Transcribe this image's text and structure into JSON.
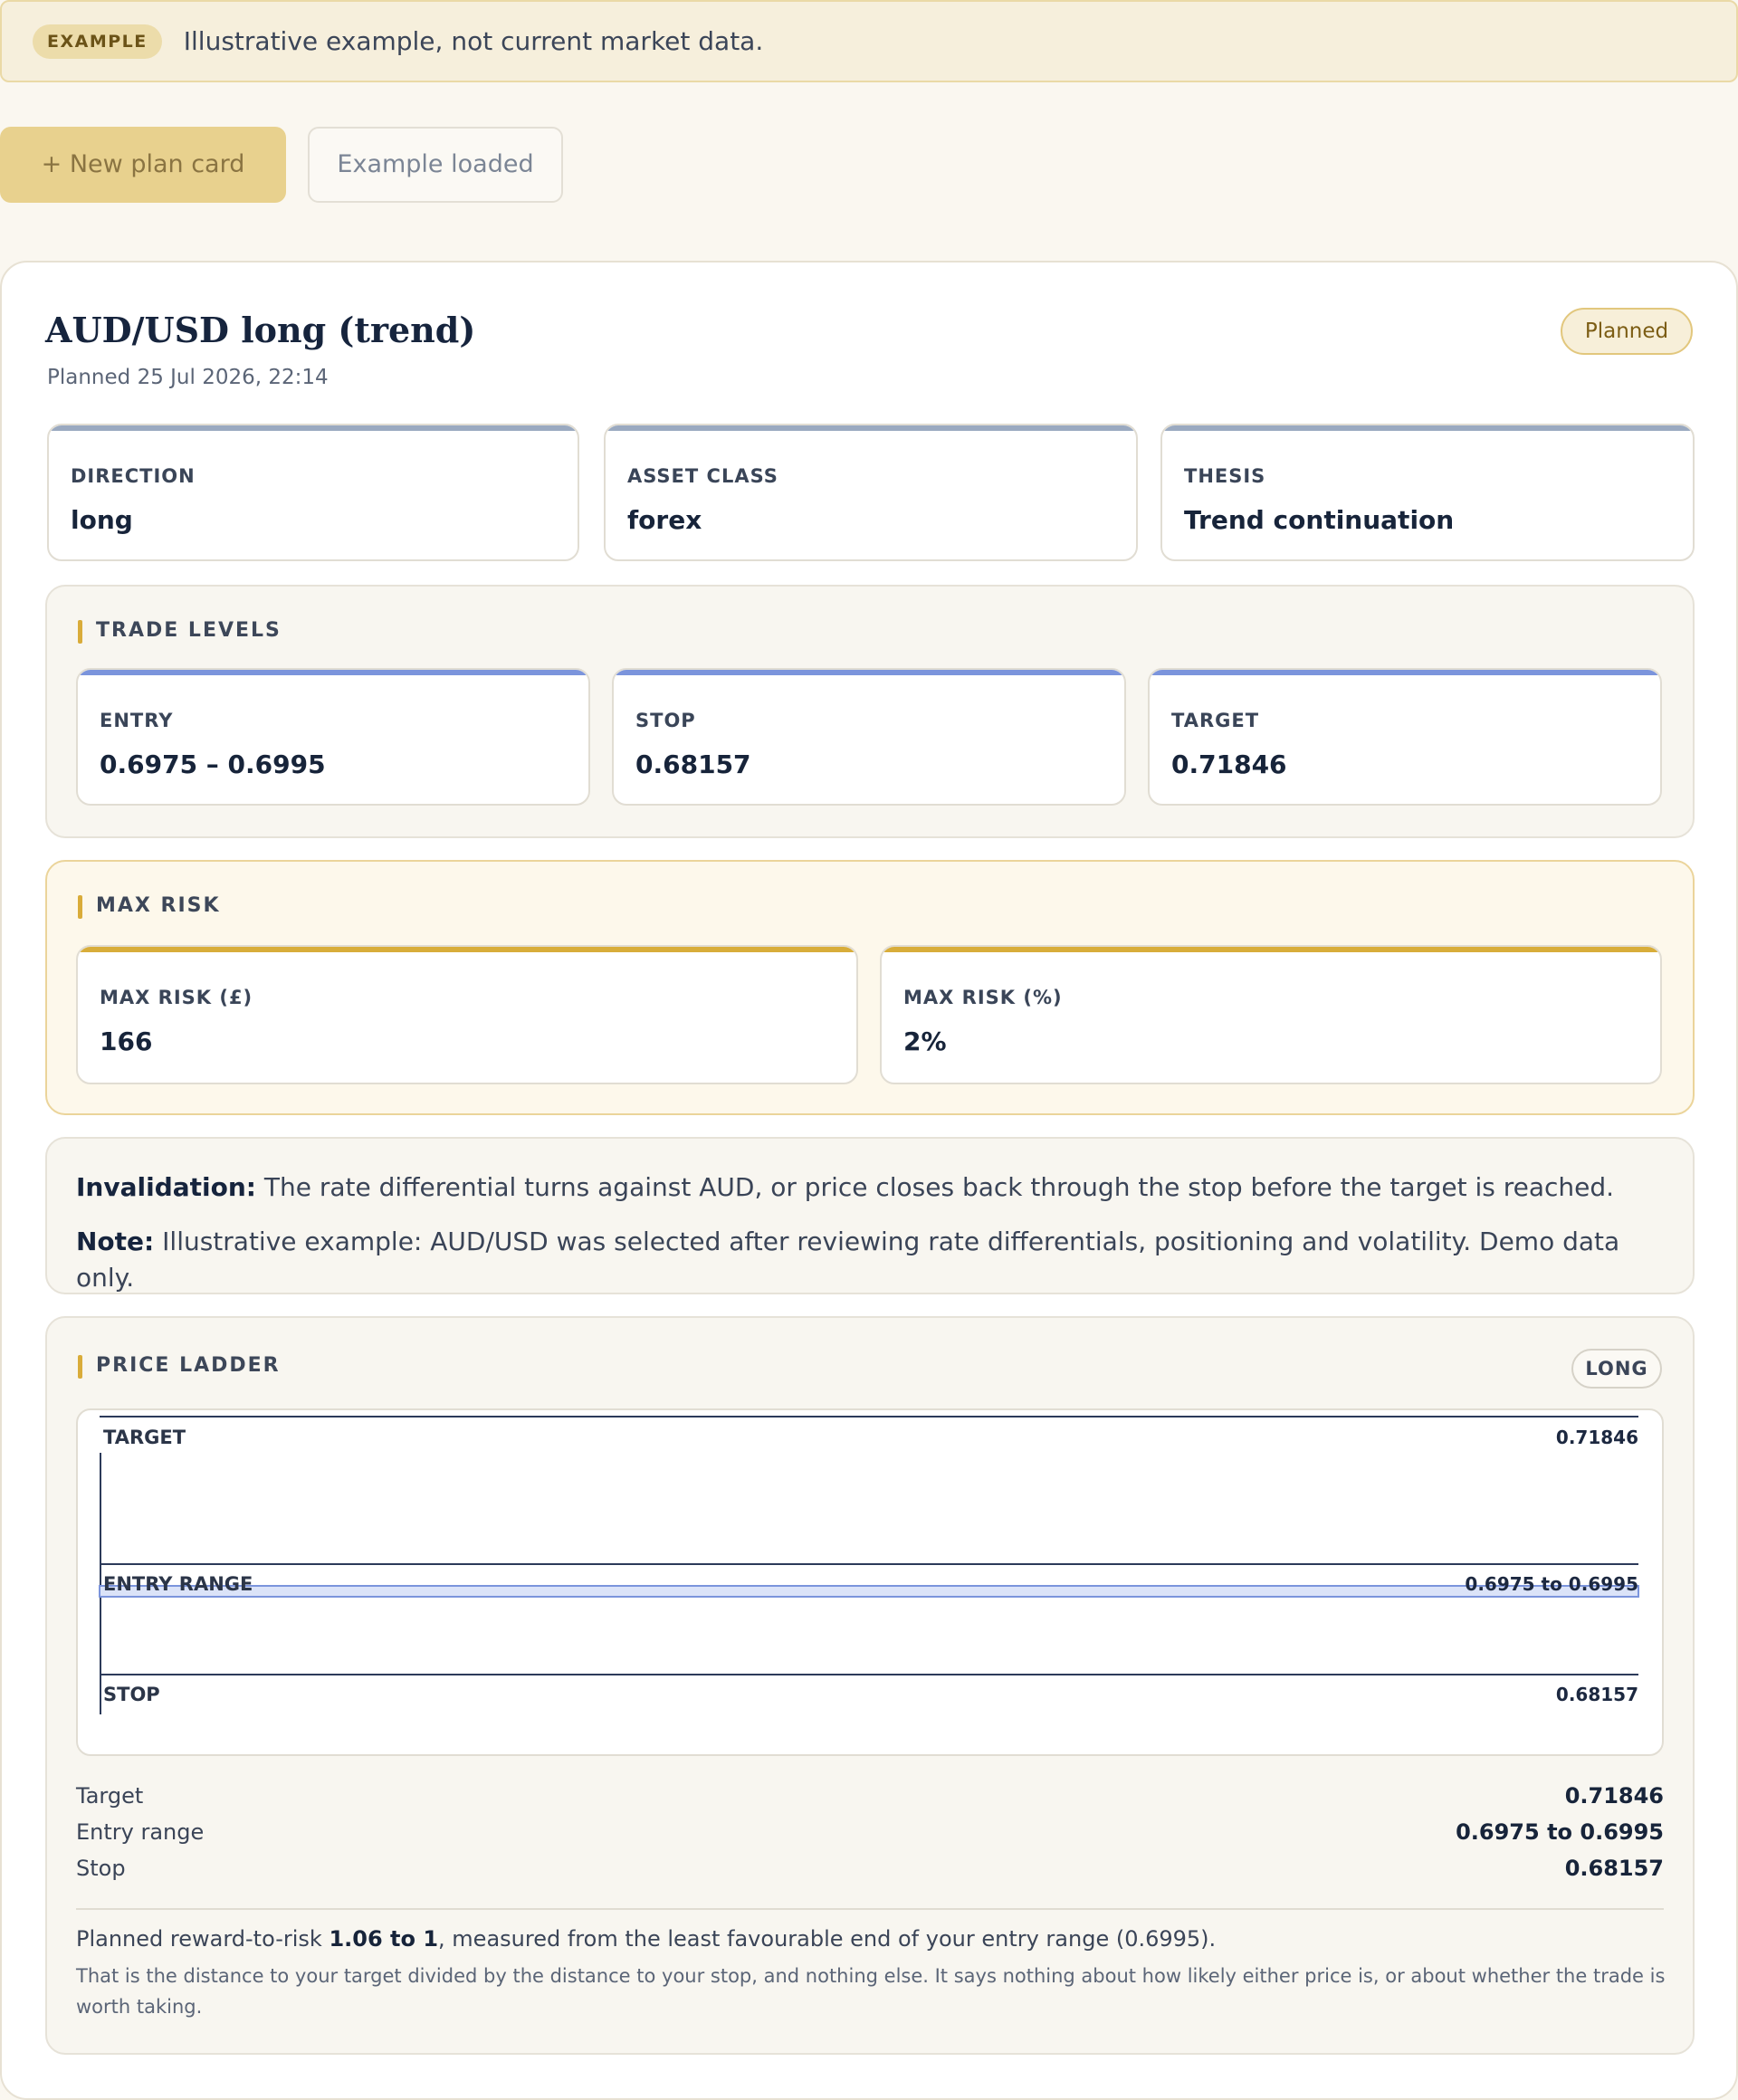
{
  "banner": {
    "badge": "EXAMPLE",
    "text": "Illustrative example, not current market data."
  },
  "toolbar": {
    "new_label": "+ New plan card",
    "example_label": "Example loaded"
  },
  "plan": {
    "title": "AUD/USD long (trend)",
    "subtitle": "Planned 25 Jul 2026, 22:14",
    "status": "Planned",
    "info": [
      {
        "label": "DIRECTION",
        "value": "long"
      },
      {
        "label": "ASSET CLASS",
        "value": "forex"
      },
      {
        "label": "THESIS",
        "value": "Trend continuation"
      }
    ]
  },
  "levels": {
    "title": "TRADE LEVELS",
    "items": [
      {
        "label": "ENTRY",
        "value": "0.6975 – 0.6995"
      },
      {
        "label": "STOP",
        "value": "0.68157"
      },
      {
        "label": "TARGET",
        "value": "0.71846"
      }
    ]
  },
  "risk": {
    "title": "MAX RISK",
    "items": [
      {
        "label": "MAX RISK (£)",
        "value": "166"
      },
      {
        "label": "MAX RISK (%)",
        "value": "2%"
      }
    ]
  },
  "notes": {
    "invalidation_label": "Invalidation:",
    "invalidation_text": " The rate differential turns against AUD, or price closes back through the stop before the target is reached.",
    "note_label": "Note:",
    "note_text": " Illustrative example: AUD/USD was selected after reviewing rate differentials, positioning and volatility. Demo data only."
  },
  "ladder": {
    "title": "PRICE LADDER",
    "badge": "LONG",
    "chart": {
      "target_label": "TARGET",
      "target_value": "0.71846",
      "entry_label": "ENTRY RANGE",
      "entry_value": "0.6975 to 0.6995",
      "stop_label": "STOP",
      "stop_value": "0.68157"
    },
    "summary": [
      {
        "label": "Target",
        "value": "0.71846"
      },
      {
        "label": "Entry range",
        "value": "0.6975 to 0.6995"
      },
      {
        "label": "Stop",
        "value": "0.68157"
      }
    ],
    "rr_prefix": "Planned reward-to-risk ",
    "rr_value": "1.06 to 1",
    "rr_suffix": ", measured from the least favourable end of your entry range (0.6995).",
    "rr_note": "That is the distance to your target divided by the distance to your stop, and nothing else. It says nothing about how likely either price is, or about whether the trade is worth taking."
  },
  "colors": {
    "accent": "#d9ac3a",
    "levels_bar": "#7b94dc",
    "risk_bar": "#d8ad3a",
    "info_bar": "#9aa9c0"
  }
}
